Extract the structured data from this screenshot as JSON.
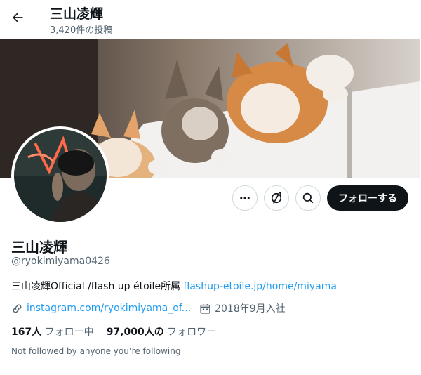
{
  "header": {
    "title": "三山凌輝",
    "post_count": "3,420件の投稿",
    "back_icon": "arrow-left-icon"
  },
  "actions": {
    "more_icon": "more-icon",
    "subscribe_icon": "subscribe-icon",
    "search_icon": "search-icon",
    "follow_label": "フォローする"
  },
  "profile": {
    "name": "三山凌輝",
    "handle": "@ryokimiyama0426",
    "bio_text": "三山凌輝Official /flash up étoile所属 ",
    "bio_link": "flashup-etoile.jp/home/miyama",
    "website": "instagram.com/ryokimiyama_of...",
    "joined": "2018年9月入社",
    "following_count": "167人",
    "following_label": "フォロー中",
    "followers_count": "97,000人の",
    "followers_label": "フォロワー",
    "followed_note": "Not followed by anyone you’re following"
  },
  "colors": {
    "accent": "#1d9bf0",
    "text": "#0f1419",
    "secondary": "#536471",
    "follow_bg": "#0f1419"
  }
}
